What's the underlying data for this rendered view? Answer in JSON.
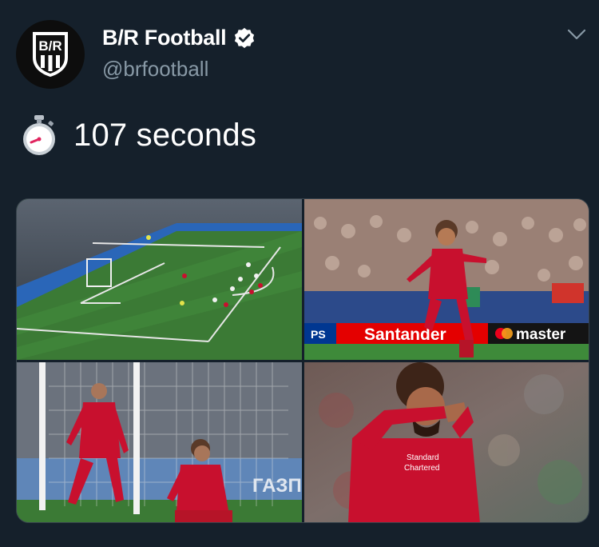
{
  "tweet": {
    "author": {
      "display_name": "B/R Football",
      "handle": "@brfootball",
      "avatar_icon": "br-logo-icon",
      "avatar_text": "B/R",
      "verified": true
    },
    "menu_icon": "chevron-down-icon",
    "emoji_icon": "stopwatch-icon",
    "text": "107 seconds",
    "media": [
      {
        "name": "photo-penalty-kick",
        "description": "penalty kick"
      },
      {
        "name": "photo-salah-celebration-run"
      },
      {
        "name": "photo-henderson-salah-goal-net"
      },
      {
        "name": "photo-salah-closeup-celebration"
      }
    ],
    "ad_boards": {
      "playstation": "PS",
      "santander": "Santander",
      "mastercard": "master"
    },
    "colors": {
      "background": "#15202b",
      "text_primary": "#ffffff",
      "text_secondary": "#8899a6",
      "verified": "#ffffff",
      "liverpool_red": "#c8102e",
      "pitch_green": "#3f7d3a"
    }
  }
}
